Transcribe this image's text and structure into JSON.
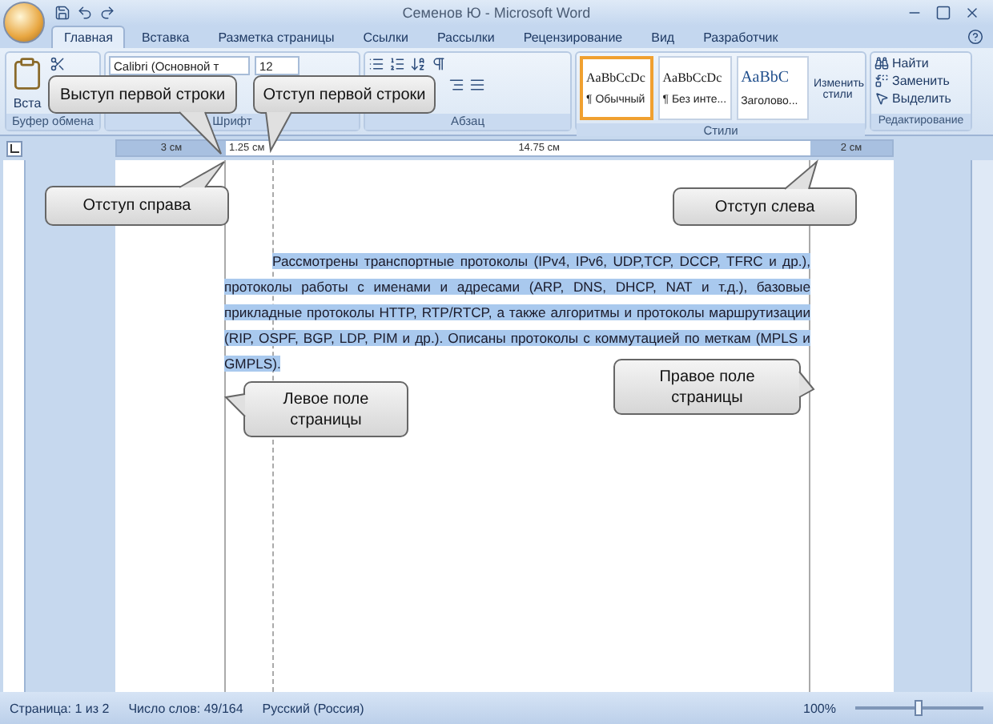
{
  "window": {
    "title": "Семенов Ю - Microsoft Word"
  },
  "tabs": [
    {
      "label": "Главная",
      "selected": true
    },
    {
      "label": "Вставка",
      "selected": false
    },
    {
      "label": "Разметка страницы",
      "selected": false
    },
    {
      "label": "Ссылки",
      "selected": false
    },
    {
      "label": "Рассылки",
      "selected": false
    },
    {
      "label": "Рецензирование",
      "selected": false
    },
    {
      "label": "Вид",
      "selected": false
    },
    {
      "label": "Разработчик",
      "selected": false
    }
  ],
  "ribbon": {
    "groups": [
      "Буфер обмена",
      "Шрифт",
      "Абзац",
      "Стили",
      "Редактирование"
    ],
    "paste_label": "Вста",
    "font_name": "Calibri (Основной т",
    "font_size": "12",
    "styles": [
      {
        "preview": "AaBbCcDc",
        "name": "¶ Обычный",
        "selected": true
      },
      {
        "preview": "AaBbCcDc",
        "name": "¶ Без инте...",
        "selected": false
      },
      {
        "preview": "AaBbC",
        "name": "Заголово...",
        "selected": false
      }
    ],
    "change_styles": "Изменить стили",
    "editing": [
      "Найти",
      "Заменить",
      "Выделить"
    ]
  },
  "ruler": {
    "labels": [
      "3 см",
      "1.25 см",
      "14.75 см",
      "2 см"
    ]
  },
  "document": {
    "paragraph": "Рассмотрены транспортные протоколы (IPv4, IPv6, UDP,TCP, DCCP, TFRC и др.), протоколы работы с именами и адресами (ARP, DNS, DHCP, NAT и т.д.), базовые прикладные протоколы HTTP, RTP/RTCP, а также алгоритмы и протоколы маршрутизации (RIP, OSPF, BGP, LDP, PIM и др.). Описаны протоколы с коммутацией по меткам (MPLS и GMPLS).",
    "selected": true
  },
  "callouts": [
    {
      "text": "Выступ первой строки"
    },
    {
      "text": "Отступ первой строки"
    },
    {
      "text": "Отступ справа"
    },
    {
      "text": "Отступ слева"
    },
    {
      "text": "Левое поле страницы"
    },
    {
      "text": "Правое поле страницы"
    }
  ],
  "status_bar": {
    "page": "Страница: 1 из 2",
    "words": "Число слов: 49/164",
    "language": "Русский (Россия)",
    "zoom": "100%",
    "zoom_slider": {
      "level": 0.5
    }
  }
}
